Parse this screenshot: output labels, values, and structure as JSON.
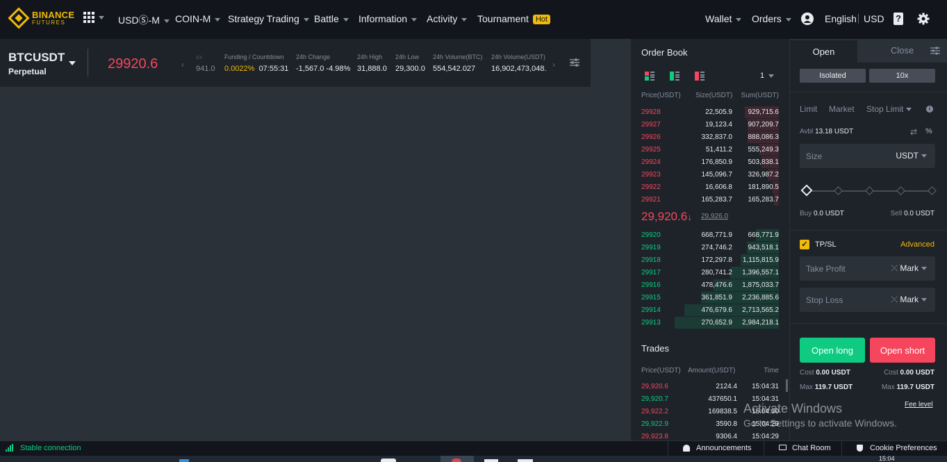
{
  "brand": {
    "name": "BINANCE",
    "sub": "FUTURES",
    "color": "#f0b90b"
  },
  "nav": {
    "apps_icon": "grid-icon",
    "items": [
      {
        "label": "USDⓈ-M"
      },
      {
        "label": "COIN-M"
      },
      {
        "label": "Strategy Trading"
      },
      {
        "label": "Battle"
      },
      {
        "label": "Information"
      },
      {
        "label": "Activity"
      },
      {
        "label": "Tournament",
        "badge": "Hot"
      }
    ],
    "right": {
      "wallet": "Wallet",
      "orders": "Orders",
      "language": "English",
      "currency": "USD"
    }
  },
  "ticker": {
    "symbol": "BTCUSDT",
    "contract": "Perpetual",
    "last_price": "29920.6",
    "mark_partial": "941.0",
    "stats": [
      {
        "label": "Funding / Countdown",
        "value_a": "0.0022%",
        "value_b": "07:55:31"
      },
      {
        "label": "24h Change",
        "value": "-1,567.0 -4.98%"
      },
      {
        "label": "24h High",
        "value": "31,888.0"
      },
      {
        "label": "24h Low",
        "value": "29,300.0"
      },
      {
        "label": "24h Volume(BTC)",
        "value": "554,542.027"
      },
      {
        "label": "24h Volume(USDT)",
        "value": "16,902,473,048."
      }
    ]
  },
  "order_book": {
    "title": "Order Book",
    "precision": "1",
    "headers": {
      "price": "Price(USDT)",
      "size": "Size(USDT)",
      "sum": "Sum(USDT)"
    },
    "asks": [
      {
        "price": "29928",
        "size": "22,505.9",
        "sum": "929,715.6",
        "depth": 0.33
      },
      {
        "price": "29927",
        "size": "19,123.4",
        "sum": "907,209.7",
        "depth": 0.3
      },
      {
        "price": "29926",
        "size": "332,837.0",
        "sum": "888,086.3",
        "depth": 0.3
      },
      {
        "price": "29925",
        "size": "51,411.2",
        "sum": "555,249.3",
        "depth": 0.19
      },
      {
        "price": "29924",
        "size": "176,850.9",
        "sum": "503,838.1",
        "depth": 0.17
      },
      {
        "price": "29923",
        "size": "145,096.7",
        "sum": "326,987.2",
        "depth": 0.11
      },
      {
        "price": "29922",
        "size": "16,606.8",
        "sum": "181,890.5",
        "depth": 0.06
      },
      {
        "price": "29921",
        "size": "165,283.7",
        "sum": "165,283.7",
        "depth": 0.05
      }
    ],
    "mid_price": "29,920.6",
    "mid_arrow": "↓",
    "mark_price": "29,926.0",
    "bids": [
      {
        "price": "29920",
        "size": "668,771.9",
        "sum": "668,771.9",
        "depth": 0.22
      },
      {
        "price": "29919",
        "size": "274,746.2",
        "sum": "943,518.1",
        "depth": 0.31
      },
      {
        "price": "29918",
        "size": "172,297.8",
        "sum": "1,115,815.9",
        "depth": 0.37
      },
      {
        "price": "29917",
        "size": "280,741.2",
        "sum": "1,396,557.1",
        "depth": 0.47
      },
      {
        "price": "29916",
        "size": "478,476.6",
        "sum": "1,875,033.7",
        "depth": 0.63
      },
      {
        "price": "29915",
        "size": "361,851.9",
        "sum": "2,236,885.6",
        "depth": 0.75
      },
      {
        "price": "29914",
        "size": "476,679.6",
        "sum": "2,713,565.2",
        "depth": 0.91
      },
      {
        "price": "29913",
        "size": "270,652.9",
        "sum": "2,984,218.1",
        "depth": 1.0
      }
    ]
  },
  "trades": {
    "title": "Trades",
    "headers": {
      "price": "Price(USDT)",
      "amount": "Amount(USDT)",
      "time": "Time"
    },
    "rows": [
      {
        "price": "29,920.6",
        "amount": "2124.4",
        "time": "15:04:31",
        "side": "sell"
      },
      {
        "price": "29,920.7",
        "amount": "437650.1",
        "time": "15:04:31",
        "side": "buy"
      },
      {
        "price": "29,922.2",
        "amount": "169838.5",
        "time": "15:04:30",
        "side": "sell"
      },
      {
        "price": "29,922.9",
        "amount": "3590.8",
        "time": "15:04:29",
        "side": "buy"
      },
      {
        "price": "29,923.8",
        "amount": "9306.4",
        "time": "15:04:29",
        "side": "sell"
      }
    ]
  },
  "trade_panel": {
    "tabs": {
      "open": "Open",
      "close": "Close"
    },
    "margin_mode": "Isolated",
    "leverage": "10x",
    "order_types": {
      "limit": "Limit",
      "market": "Market",
      "stop_limit": "Stop Limit"
    },
    "avbl_label": "Avbl",
    "avbl_value": "13.18 USDT",
    "size_placeholder": "Size",
    "size_unit": "USDT",
    "slider_percent": 0,
    "buy_label": "Buy",
    "buy_value": "0.0 USDT",
    "sell_label": "Sell",
    "sell_value": "0.0 USDT",
    "tpsl_label": "TP/SL",
    "tpsl_checked": true,
    "advanced": "Advanced",
    "take_profit": "Take Profit",
    "stop_loss": "Stop Loss",
    "trigger": "Mark",
    "open_long": "Open long",
    "open_short": "Open short",
    "cost_label": "Cost",
    "cost_long": "0.00 USDT",
    "cost_short": "0.00 USDT",
    "max_label": "Max",
    "max_long": "119.7 USDT",
    "max_short": "119.7 USDT",
    "fee_level": "Fee level"
  },
  "watermark": {
    "title": "Activate Windows",
    "sub": "Go to Settings to activate Windows."
  },
  "footer": {
    "connection": "Stable connection",
    "announcements": "Announcements",
    "chat": "Chat Room",
    "cookies": "Cookie Preferences"
  },
  "taskbar": {
    "clock": "15:04"
  },
  "colors": {
    "up": "#0ecb81",
    "down": "#f6465d",
    "accent": "#f0b90b"
  }
}
